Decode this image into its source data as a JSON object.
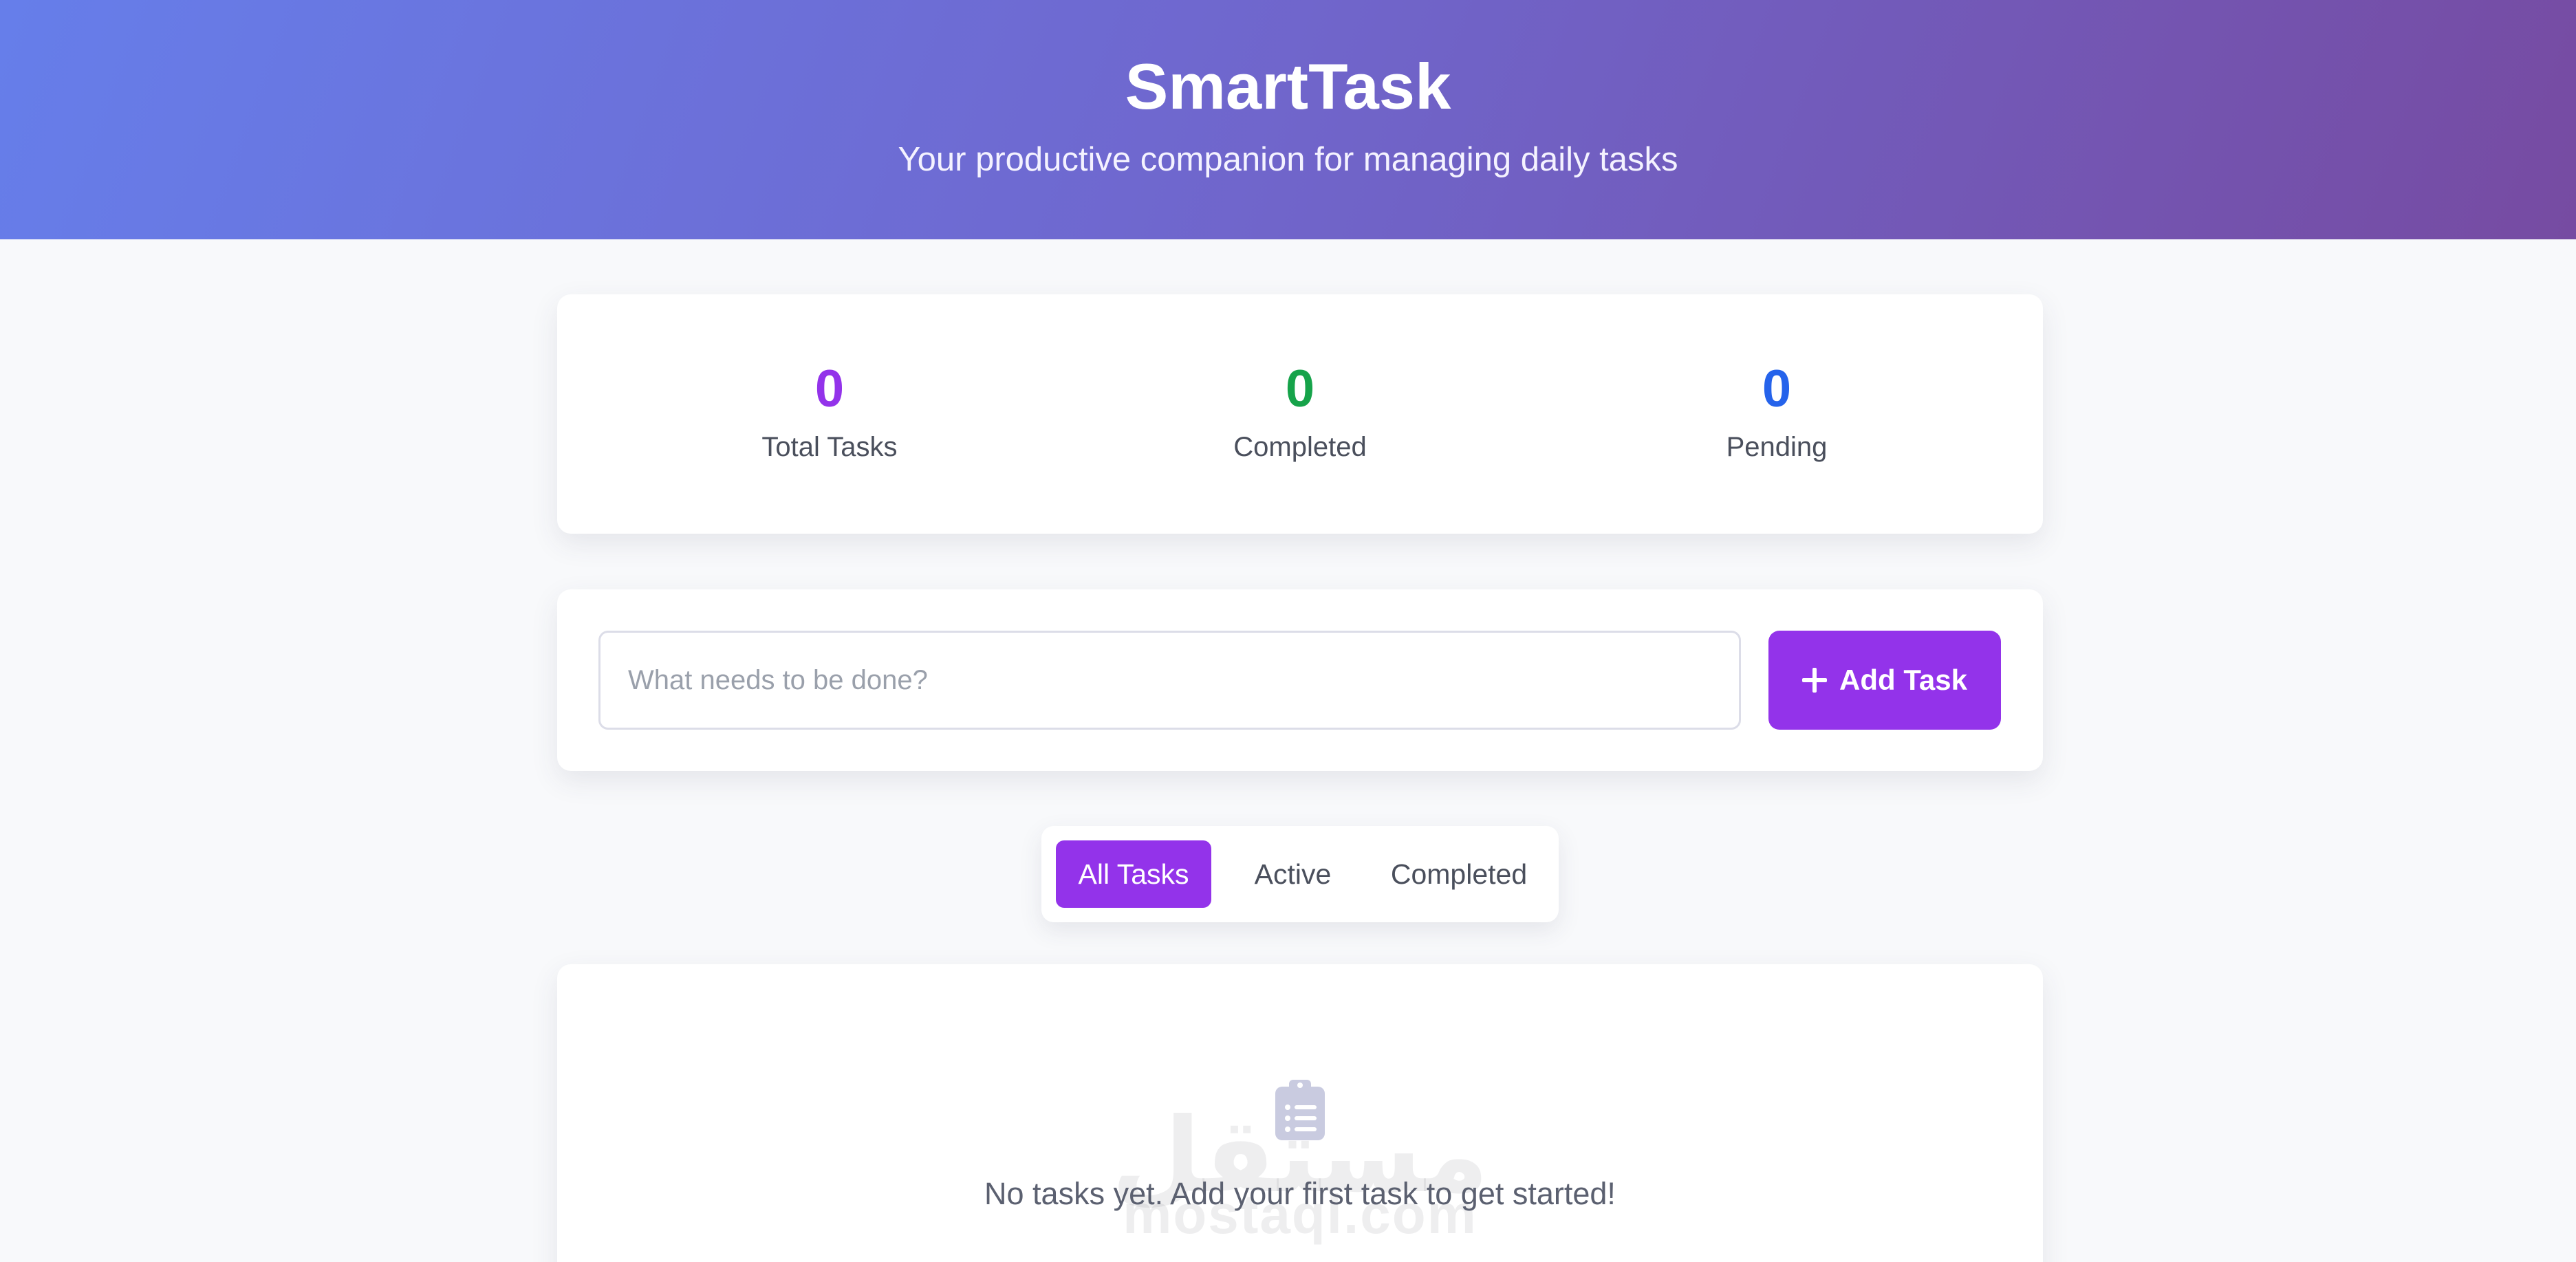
{
  "header": {
    "title": "SmartTask",
    "subtitle": "Your productive companion for managing daily tasks"
  },
  "stats": {
    "total": {
      "value": "0",
      "label": "Total Tasks",
      "color": "#9333ea"
    },
    "completed": {
      "value": "0",
      "label": "Completed",
      "color": "#16a34a"
    },
    "pending": {
      "value": "0",
      "label": "Pending",
      "color": "#2563eb"
    }
  },
  "add_task": {
    "input_value": "",
    "input_placeholder": "What needs to be done?",
    "button_label": "Add Task",
    "button_icon": "plus-icon"
  },
  "filters": {
    "tabs": [
      {
        "label": "All Tasks",
        "active": true
      },
      {
        "label": "Active",
        "active": false
      },
      {
        "label": "Completed",
        "active": false
      }
    ]
  },
  "task_list": {
    "items": [],
    "empty_icon": "clipboard-list-icon",
    "empty_message": "No tasks yet. Add your first task to get started!"
  },
  "watermark": {
    "arabic": "مستقل",
    "latin": "mostaql.com"
  },
  "colors": {
    "accent": "#9333ea",
    "header_gradient_start": "#667eea",
    "header_gradient_end": "#764ba2",
    "background": "#f8f9fb"
  }
}
